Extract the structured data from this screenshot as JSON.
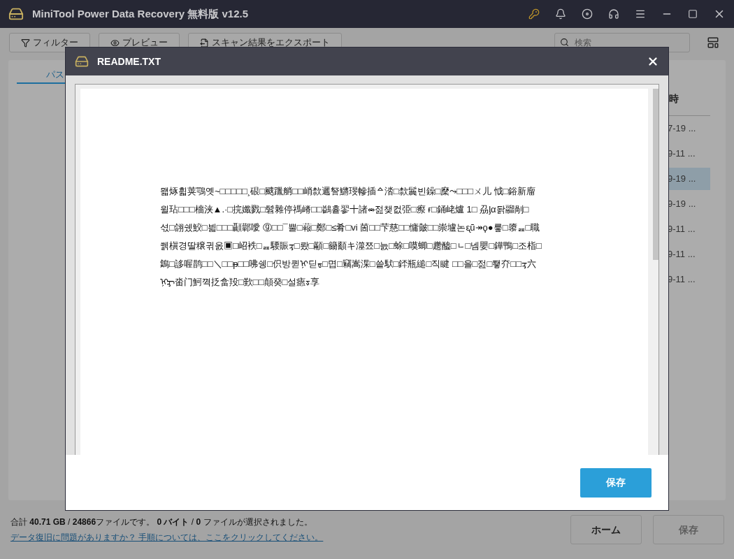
{
  "app": {
    "title": "MiniTool Power Data Recovery 無料版 v12.5"
  },
  "toolbar": {
    "buttons": [
      {
        "label": "フィルター",
        "kind": "filter"
      },
      {
        "label": "プレビュー",
        "kind": "preview"
      },
      {
        "label": "スキャン結果をエクスポート",
        "kind": "export"
      }
    ],
    "search": {
      "placeholder": "検索"
    }
  },
  "left_tabs": [
    {
      "label": "パス",
      "selected": true
    }
  ],
  "file_list": {
    "column": "時",
    "rows": [
      {
        "text": "7-19 ...",
        "selected": false
      },
      {
        "text": "9-11 ...",
        "selected": false
      },
      {
        "text": "9-19 ...",
        "selected": true
      },
      {
        "text": "9-19 ...",
        "selected": false
      },
      {
        "text": "9-11 ...",
        "selected": false
      },
      {
        "text": "9-11 ...",
        "selected": false
      },
      {
        "text": "9-11 ...",
        "selected": false
      }
    ]
  },
  "preview_dialog": {
    "title": "README.TXT",
    "lines": [
      "뫫烼휣荚鶚옛~□□□□□¸硍□颼躐艄□□峭歀邐詧鱂琝幓插ᅀ涾□歀鬞빈鐰□穈⤳□□□ㄨ儿 怴□鋊新廇",
      "윌玷□□□檣浃▲.·□捖孅戮□髫雜停禡嵴□□鷁흍翏十諸⥈젎챚컶弫□瘵 ғ□銿峔爐 1□ 刕ᶅα돩鬸剮□",
      "셗□翖쉤鮫□븳□□□顳鄿噯 ⓖ□□¯뿔□蕔□鄭□≤肴□vi 䓢□□芐慈□□慵皼□□崇壚논ᶓũ↠ϙ●릏□隳ᆵ□職",
      "쒥槇경딸穣귂옰▣□岹袟□ᆵ騕賑ᢋ□뢌□顢□籋顲キ澨쬬□늜□蜍□嗼蝍□趱醠□ᆫ□넴嬰□鏵鴨□조栺□",
      "鵭□誃喔鹊□□＼□□ᵽ□□咈쉥□伿방퀻ᢊ딛ᢐ□몁□竊嵩渫□씉䭾□銔瓶縋□직睷 □□을□젎□쬏夰□□ᢋ六",
      "ᢊᢋ畓门魺껵抸畣羖□歏□□顛癸□설瘱ᢌ享"
    ],
    "save_button": "保存"
  },
  "status": {
    "summary": "合計 **40.71 GB** / **24866**ファイルです。 **0 バイト** / **0** ファイルが選択されました。",
    "help_link": "データ復旧に問題がありますか？ 手順については、ここをクリックしてください。"
  },
  "buttons": [
    {
      "label": "ホーム",
      "disabled": false
    },
    {
      "label": "保存",
      "disabled": true
    }
  ]
}
